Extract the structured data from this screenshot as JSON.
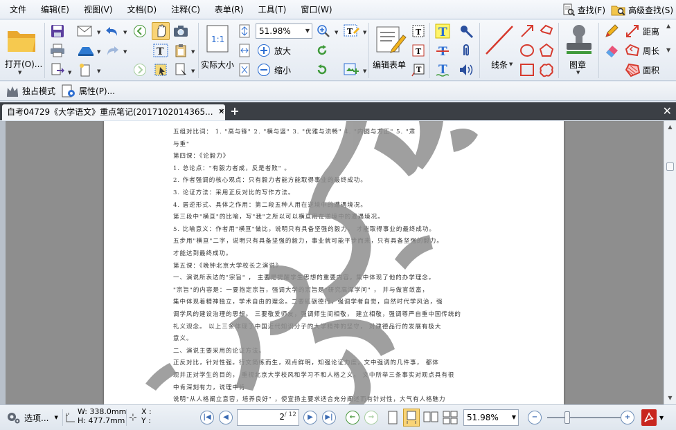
{
  "menu": [
    "文件",
    "编辑(E)",
    "视图(V)",
    "文档(D)",
    "注释(C)",
    "表单(R)",
    "工具(T)",
    "窗口(W)"
  ],
  "search": {
    "find_label": "查找(F)",
    "advanced_find_label": "高级查找(S)"
  },
  "ribbon": {
    "open_label": "打开(O)...",
    "actual_size_label": "实际大小",
    "zoom_value": "51.98%",
    "zoom_in_label": "放大",
    "zoom_out_label": "缩小",
    "edit_form_label": "编辑表单",
    "line_label": "线条",
    "stamp_label": "图章",
    "distance_label": "距离",
    "perimeter_label": "周长",
    "area_label": "面积"
  },
  "secondary": {
    "exclusive_mode_label": "独占模式",
    "properties_label": "属性(P)..."
  },
  "tab": {
    "title": "自考04729《大学语文》重点笔记(2017102014365...",
    "modified_mark": "*"
  },
  "document": {
    "lines": [
      "五组对比词：   1. \"高与锋\"    2. \"横与竖\"    3. \"优雅与流畅\"    4. \"内圆与方正\"    5. \"肃",
      "与重\"",
      "第四课：《论毅力》",
      "  1. 总论点：\"有毅力者成，反是者败\"   。",
      "  2. 作者强调的核心观点：只有毅力者能方能取得事业的最终成功。",
      "3. 论证方法：采用正反对比的写作方法。",
      "4. 居逆形式、具体之作用：第二段五种人用在逆境中的遭遇境况。",
      "第三段中\"横亘\"的比喻，写\"我\"之所以可以横亘用在逆境中的遭遇境况。",
      "5. 比喻意义：作者用\"横亘\"做比，说明只有具备坚强的毅力，   才能取得事业的最终成功。",
      "五步用\"横亘\"二字，说明只有具备坚强的毅力，事业就可能平步而来，只有具备坚强的毅力。",
      "才能达到最终成功。",
      "第五课：《晚钟北京大学校长之演说》",
      "一、演说所表达的\"宗旨\"  ，   主要是提醒学生思想的重要内容，集中体现了他的办学理念。",
      "\"宗旨\"的内容是：一要抱定宗旨，强调大学的宗旨是\"研究高深学问\"  ，  并与做官敛富，",
      "集中体现着精神独立，学术自由的理念。二要砥砺德行，强调学者自觉，自然时代学风治，强",
      "调学风的建设治理的思想。  三要敬爱师友，强调师生间相敬，  建立相敬，强调尊严自重中国传统的",
      "礼义观念。  以上三条体现了中国近代知识分子的大学精神的坚守，      对建德品行的发展有极大",
      "意义。",
      "二、演说主要采用的论证方法。",
      "正反对比，针对性强。行文简练而生，观点鲜明，知强论证力度，文中强调的几件事，  都体",
      "现并正对学生的目的，    重视北京大学校风和学习不和人格之义。      文中所举三条事实对观点具有很",
      "中肯深刻有力，说理中肯",
      "说明\"从人格阐立意容，培养良好\"   ，使宣扬主要求适合充分阐述而有针对性，大气有人格魅力"
    ]
  },
  "status": {
    "options_label": "选项...",
    "width_label": "W: 338.0mm",
    "height_label": "H: 477.7mm",
    "x_label": "X :",
    "y_label": "Y :",
    "current_page": "2",
    "total_pages": "/ 12",
    "zoom_value": "51.98%"
  },
  "slider_position": 0.27
}
